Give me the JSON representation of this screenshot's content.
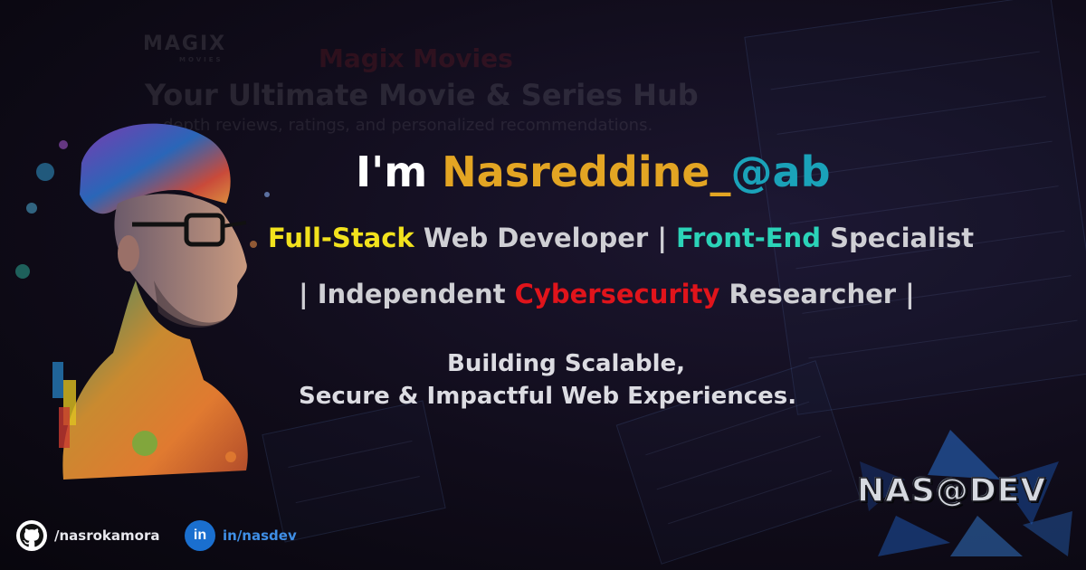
{
  "background": {
    "brand": "MAGIX",
    "brand_sub": "MOVIES",
    "site_title": "Magix Movies",
    "hub_title": "Your Ultimate Movie & Series Hub",
    "hub_desc": "depth reviews, ratings, and personalized recommendations."
  },
  "headline": {
    "prefix": "I'm",
    "name": "Nasreddine_",
    "suffix": "@ab"
  },
  "roles": {
    "line1": {
      "part1_highlight": "Full-Stack",
      "part1_rest": " Web Developer ",
      "divider": " | ",
      "part2_highlight": "Front-End",
      "part2_rest": " Specialist"
    },
    "line2": {
      "open": "| Independent ",
      "highlight": "Cybersecurity",
      "close": " Researcher |"
    }
  },
  "tagline": {
    "line1": "Building Scalable,",
    "line2": "Secure & Impactful Web Experiences."
  },
  "socials": {
    "github": {
      "handle": "/nasrokamora",
      "icon": "github-icon"
    },
    "linkedin": {
      "handle": "in/nasdev",
      "icon_text": "in",
      "icon": "linkedin-icon"
    }
  },
  "logo": {
    "text": "NAS@DEV"
  },
  "colors": {
    "gold": "#e3a523",
    "teal": "#1aa2b9",
    "yellow": "#f2e21d",
    "mint": "#2bd3b8",
    "red": "#e0141b",
    "linkedin": "#1a6fcf"
  }
}
